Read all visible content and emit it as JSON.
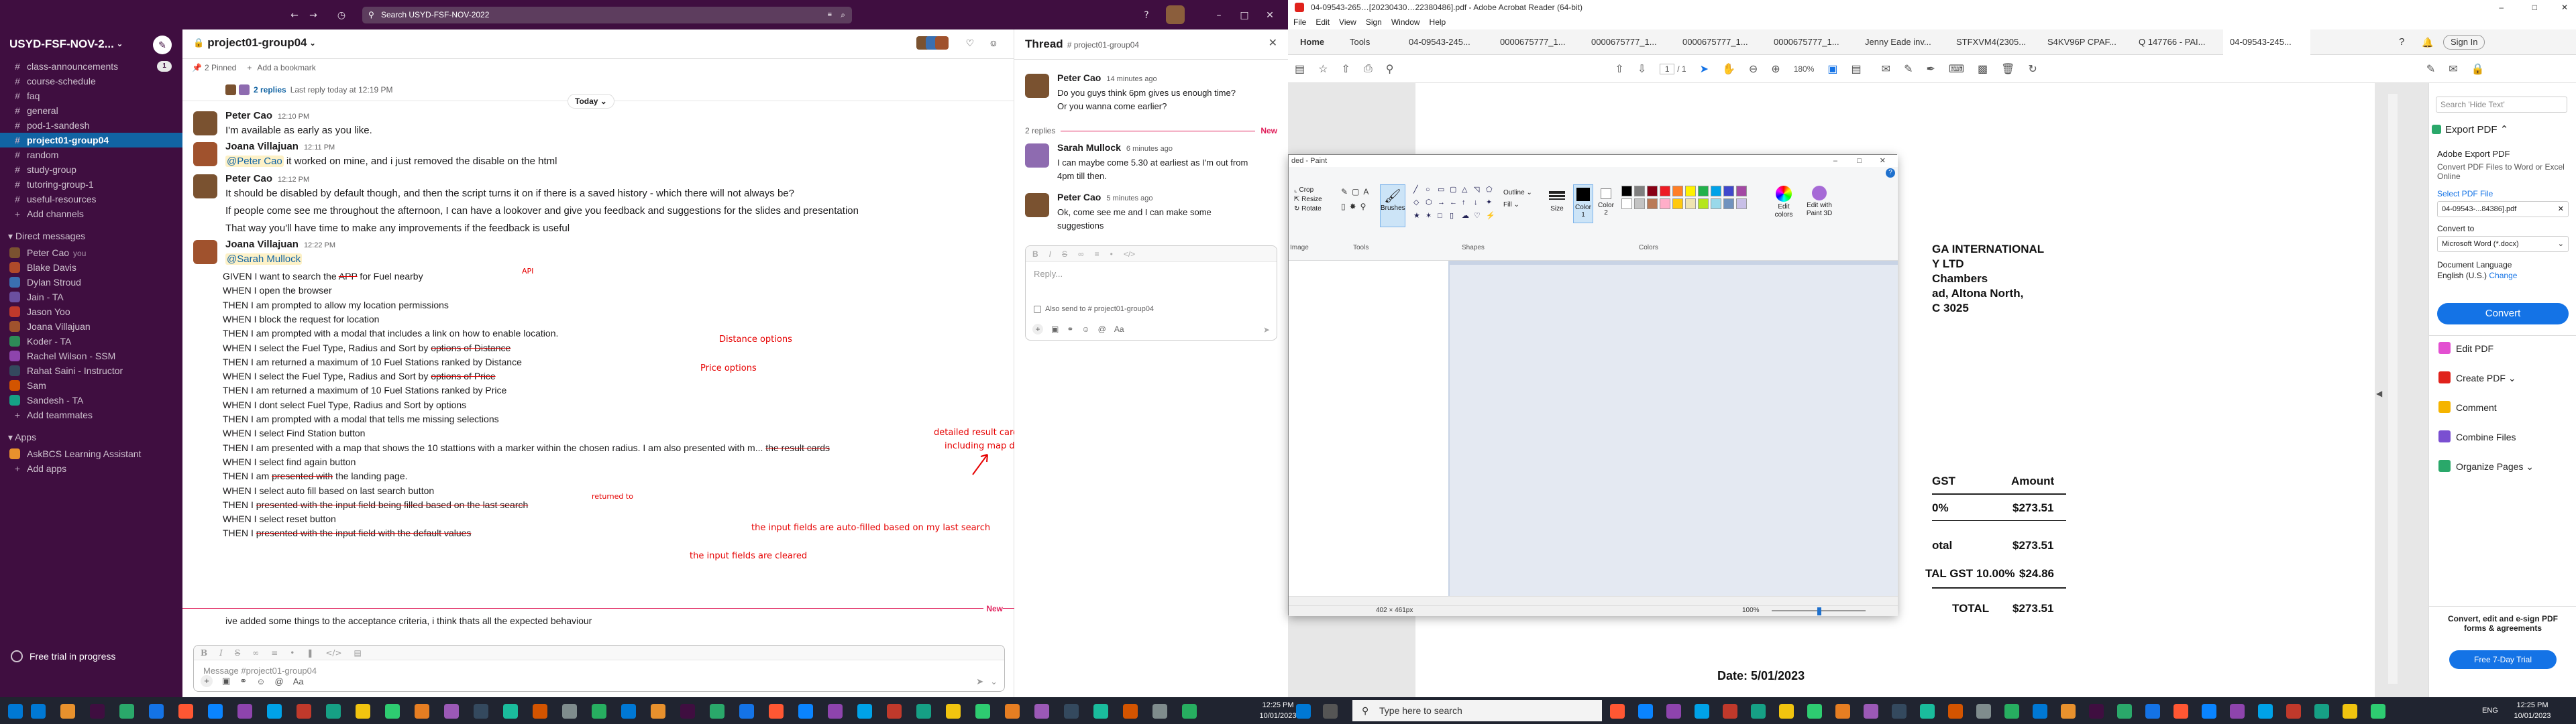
{
  "slack": {
    "search_text": "Search USYD-FSF-NOV-2022",
    "workspace": "USYD-FSF-NOV-2...",
    "channels": [
      {
        "label": "class-announcements",
        "badge": "1"
      },
      {
        "label": "course-schedule"
      },
      {
        "label": "faq"
      },
      {
        "label": "general"
      },
      {
        "label": "pod-1-sandesh"
      },
      {
        "label": "project01-group04"
      },
      {
        "label": "random"
      },
      {
        "label": "study-group"
      },
      {
        "label": "tutoring-group-1"
      },
      {
        "label": "useful-resources"
      }
    ],
    "add_channels": "Add channels",
    "dm_header": "Direct messages",
    "dms": [
      {
        "name": "Peter Cao",
        "suffix": "you",
        "color": "#7a5230"
      },
      {
        "name": "Blake Davis",
        "color": "#b04a2a"
      },
      {
        "name": "Dylan Stroud",
        "color": "#3a6fb0"
      },
      {
        "name": "Jain - TA",
        "color": "#6b4fa0"
      },
      {
        "name": "Jason Yoo",
        "color": "#c0392b"
      },
      {
        "name": "Joana Villajuan",
        "color": "#a0522d"
      },
      {
        "name": "Koder - TA",
        "color": "#2e8b57"
      },
      {
        "name": "Rachel Wilson - SSM",
        "color": "#8e44ad"
      },
      {
        "name": "Rahat Saini - Instructor",
        "color": "#34495e"
      },
      {
        "name": "Sam",
        "color": "#d35400"
      },
      {
        "name": "Sandesh - TA",
        "color": "#16a085"
      }
    ],
    "add_teammates": "Add teammates",
    "apps_header": "Apps",
    "apps": [
      {
        "name": "AskBCS Learning Assistant"
      }
    ],
    "add_apps": "Add apps",
    "trial": "Free trial in progress",
    "footer_channel": "project01-group04",
    "channel": {
      "title": "project01-group04",
      "pinned": "2 Pinned",
      "bookmark": "Add a bookmark",
      "replies": "2 replies",
      "replies_meta": "Last reply today at 12:19 PM",
      "date_divider": "Today",
      "new_label": "New",
      "composer_placeholder": "Message #project01-group04",
      "messages": [
        {
          "author": "Peter Cao",
          "time": "12:10 PM",
          "text": "I'm available as early as you like."
        },
        {
          "author": "Joana Villajuan",
          "time": "12:11 PM",
          "mention": "@Peter Cao",
          "text": " it worked on mine, and i just removed the disable on the html"
        },
        {
          "author": "Peter Cao",
          "time": "12:12 PM",
          "lines": [
            "It should be disabled by default though, and then the script turns it on if there is a saved history - which there will not always be?",
            "If people come see me throughout the afternoon, I can have a lookover and give you feedback and suggestions for the slides and presentation",
            "That way you'll have time to make any improvements if the feedback is useful"
          ]
        },
        {
          "author": "Joana Villajuan",
          "time": "12:22 PM",
          "mention": "@Sarah Mullock"
        }
      ],
      "criteria": [
        "GIVEN I want to search the APP for Fuel nearby",
        "WHEN I open the browser",
        "THEN I am prompted to allow my location permissions",
        "WHEN I block the request for location",
        "THEN I am prompted with a modal that includes a link on how to enable location.",
        "WHEN I select the Fuel Type, Radius and Sort by options of Distance",
        "THEN I am returned a maximum of 10 Fuel Stations ranked by Distance",
        "WHEN I select the Fuel Type, Radius and Sort by options of Price",
        "THEN I am returned a maximum of 10 Fuel Stations ranked by Price",
        "WHEN I dont select Fuel Type, Radius and Sort by options",
        "THEN I am prompted with a modal that tells me missing selections",
        "WHEN I select Find Station button",
        "THEN I am presented with a map that shows the 10 stattions with a marker within the chosen radius. I am also presented with m... the result cards",
        "WHEN I select find again button",
        "THEN I am presented with the landing page.",
        "WHEN I select auto fill based on last search button",
        "THEN I presented with the input field being filled based on the last search",
        "WHEN I select reset button",
        "THEN I presented with the input field with the default values"
      ],
      "annotations": {
        "api": "API",
        "distance": "Distance options",
        "price": "Price options",
        "cards1": "detailed result cards   for each station ,",
        "cards2": "including map directions visualised",
        "returned": "returned to",
        "autofill": "the input fields are auto-filled based on my last search",
        "cleared": "the input fields are cleared"
      },
      "last_message": "ive added some things to the acceptance criteria, i think thats all the expected behaviour"
    },
    "thread": {
      "title": "Thread",
      "channel": "# project01-group04",
      "parent": {
        "author": "Peter Cao",
        "time": "14 minutes ago",
        "lines": [
          "Do you guys think 6pm gives us enough time?",
          "Or you wanna come earlier?"
        ]
      },
      "replies_label": "2 replies",
      "new_label": "New",
      "replies": [
        {
          "author": "Sarah Mullock",
          "time": "6 minutes ago",
          "lines": [
            "I can maybe come 5.30 at earliest as I'm out from",
            "4pm till then."
          ]
        },
        {
          "author": "Peter Cao",
          "time": "5 minutes ago",
          "lines": [
            "Ok, come see me and I can make some",
            "suggestions"
          ]
        }
      ],
      "reply_placeholder": "Reply...",
      "also_send": "Also send to # project01-group04"
    }
  },
  "acrobat": {
    "title": "04-09543-265…[20230430…22380486].pdf - Adobe Acrobat Reader (64-bit)",
    "menu": [
      "File",
      "Edit",
      "View",
      "Sign",
      "Window",
      "Help"
    ],
    "nav_tabs": [
      "Home",
      "Tools"
    ],
    "tabs": [
      "04-09543-245...",
      "0000675777_1...",
      "0000675777_1...",
      "0000675777_1...",
      "0000675777_1...",
      "Jenny Eade inv...",
      "STFXVM4(2305...",
      "S4KV96P CPAF...",
      "Q 147766 - PAI...",
      "04-09543-245..."
    ],
    "sign_in": "Sign In",
    "page_current": "1",
    "page_total": "/ 1",
    "zoom": "180%",
    "invoice": {
      "company1": "GA INTERNATIONAL",
      "company2": "Y LTD",
      "addr1": "Chambers",
      "addr2": "ad, Altona North,",
      "addr3": "C 3025",
      "col_gst": "GST",
      "col_amount": "Amount",
      "pct": "0%",
      "amt1": "$273.51",
      "total_label": "otal",
      "amt2": "$273.51",
      "gst_label": "TAL GST 10.00%",
      "gst_amt": "$24.86",
      "grand_label": "TOTAL",
      "grand_amt": "$273.51",
      "date": "Date: 5/01/2023"
    },
    "panel": {
      "search_placeholder": "Search 'Hide Text'",
      "export_title": "Export PDF",
      "export_sub": "Adobe Export PDF",
      "export_desc": "Convert PDF Files to Word or Excel Online",
      "select_file": "Select PDF File",
      "file_name": "04-09543-...84386].pdf",
      "convert_to": "Convert to",
      "format": "Microsoft Word (*.docx)",
      "lang_label": "Document Language",
      "lang": "English (U.S.)",
      "change": "Change",
      "convert_btn": "Convert",
      "tools": [
        "Edit PDF",
        "Create PDF",
        "Comment",
        "Combine Files",
        "Organize Pages"
      ],
      "promo": "Convert, edit and e-sign PDF forms & agreements",
      "trial_btn": "Free 7-Day Trial"
    }
  },
  "paint": {
    "title": "ded - Paint",
    "groups": [
      "Image",
      "Tools",
      "Shapes",
      "Colors"
    ],
    "crop": "Crop",
    "resize": "Resize",
    "rotate": "Rotate",
    "brushes": "Brushes",
    "outline": "Outline",
    "fill": "Fill",
    "size": "Size",
    "color1": "Color 1",
    "color2": "Color 2",
    "edit_colors": "Edit colors",
    "edit_3d": "Edit with Paint 3D",
    "dimensions": "402 × 461px",
    "zoom": "100%",
    "palette": [
      "#000000",
      "#7f7f7f",
      "#880015",
      "#ed1c24",
      "#ff7f27",
      "#fff200",
      "#22b14c",
      "#00a2e8",
      "#3f48cc",
      "#a349a4",
      "#ffffff",
      "#c3c3c3",
      "#b97a57",
      "#ffaec9",
      "#ffc90e",
      "#efe4b0",
      "#b5e61d",
      "#99d9ea",
      "#7092be",
      "#c8bfe7"
    ]
  },
  "taskbar": {
    "search_placeholder": "Type here to search",
    "time": "12:25 PM",
    "date": "10/01/2023",
    "lang": "ENG"
  }
}
